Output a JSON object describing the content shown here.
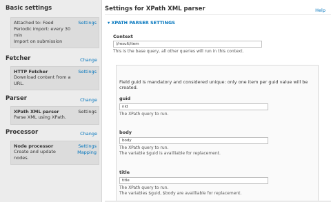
{
  "sidebar": {
    "basic": {
      "title": "Basic settings",
      "lines": [
        "Attached to: Feed",
        "Periodic import: every 30",
        "min",
        "Import on submission"
      ],
      "action": "Settings"
    },
    "fetcher": {
      "title": "Fetcher",
      "change": "Change",
      "name": "HTTP Fetcher",
      "desc": [
        "Download content from a",
        "URL."
      ],
      "action": "Settings"
    },
    "parser": {
      "title": "Parser",
      "change": "Change",
      "name": "XPath XML parser",
      "desc": [
        "Parse XML using XPath."
      ],
      "action": "Settings"
    },
    "processor": {
      "title": "Processor",
      "change": "Change",
      "name": "Node processor",
      "desc": [
        "Create and update",
        "nodes."
      ],
      "action1": "Settings",
      "action2": "Mapping"
    }
  },
  "main": {
    "title": "Settings for XPath XML parser",
    "help": "Help",
    "fieldset": "▾ XPATH PARSER SETTINGS",
    "context": {
      "label": "Context",
      "value": "//result/item",
      "desc": "This is the base query, all other queries will run in this context."
    },
    "guid_note": [
      "Field guid is mandatory and considered unique: only one item per guid value will be",
      "created."
    ],
    "guid": {
      "label": "guid",
      "value": "nid",
      "desc": "The XPath query to run."
    },
    "body": {
      "label": "body",
      "value": "body",
      "desc": [
        "The XPath query to run.",
        "The variable $guid is availliable for replacement."
      ]
    },
    "titlefield": {
      "label": "title",
      "value": "title",
      "desc": [
        "The XPath query to run.",
        "The variables $guid, $body are availliable for replacement."
      ]
    }
  }
}
